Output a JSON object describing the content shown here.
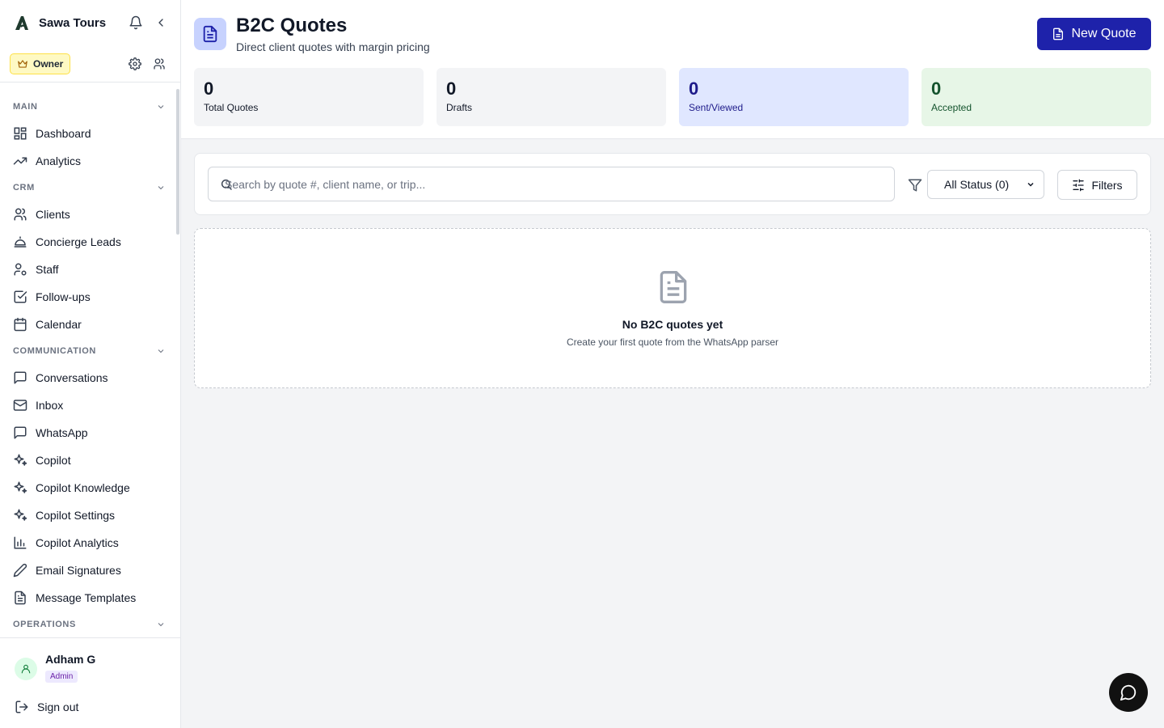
{
  "app": {
    "brand_name": "Sawa Tours",
    "role_label": "Owner"
  },
  "sidebar": {
    "sections": [
      {
        "label": "MAIN",
        "items": [
          {
            "label": "Dashboard",
            "icon": "grid-icon"
          },
          {
            "label": "Analytics",
            "icon": "trending-up-icon"
          }
        ]
      },
      {
        "label": "CRM",
        "items": [
          {
            "label": "Clients",
            "icon": "users-icon"
          },
          {
            "label": "Concierge Leads",
            "icon": "concierge-bell-icon"
          },
          {
            "label": "Staff",
            "icon": "user-cog-icon"
          },
          {
            "label": "Follow-ups",
            "icon": "check-square-icon"
          },
          {
            "label": "Calendar",
            "icon": "calendar-icon"
          }
        ]
      },
      {
        "label": "COMMUNICATION",
        "items": [
          {
            "label": "Conversations",
            "icon": "message-square-icon"
          },
          {
            "label": "Inbox",
            "icon": "mail-icon"
          },
          {
            "label": "WhatsApp",
            "icon": "message-square-icon"
          },
          {
            "label": "Copilot",
            "icon": "sparkles-icon"
          },
          {
            "label": "Copilot Knowledge",
            "icon": "sparkles-icon"
          },
          {
            "label": "Copilot Settings",
            "icon": "sparkles-icon"
          },
          {
            "label": "Copilot Analytics",
            "icon": "bar-chart-icon"
          },
          {
            "label": "Email Signatures",
            "icon": "pen-icon"
          },
          {
            "label": "Message Templates",
            "icon": "file-text-icon"
          }
        ]
      },
      {
        "label": "OPERATIONS",
        "items": []
      }
    ]
  },
  "user": {
    "name": "Adham G",
    "badge": "Admin",
    "sign_out_label": "Sign out"
  },
  "header": {
    "title": "B2C Quotes",
    "subtitle": "Direct client quotes with margin pricing",
    "new_quote_label": "New Quote"
  },
  "stats": [
    {
      "value": "0",
      "label": "Total Quotes"
    },
    {
      "value": "0",
      "label": "Drafts"
    },
    {
      "value": "0",
      "label": "Sent/Viewed"
    },
    {
      "value": "0",
      "label": "Accepted"
    }
  ],
  "filters": {
    "search_placeholder": "Search by quote #, client name, or trip...",
    "status_selected": "All Status (0)",
    "filters_label": "Filters"
  },
  "empty_state": {
    "title": "No B2C quotes yet",
    "subtitle": "Create your first quote from the WhatsApp parser"
  },
  "colors": {
    "primary": "#1e22aa",
    "owner_badge_bg": "#fef9c3",
    "sent_stat_bg": "#e0e7ff",
    "accepted_stat_bg": "#e7f6e7"
  }
}
